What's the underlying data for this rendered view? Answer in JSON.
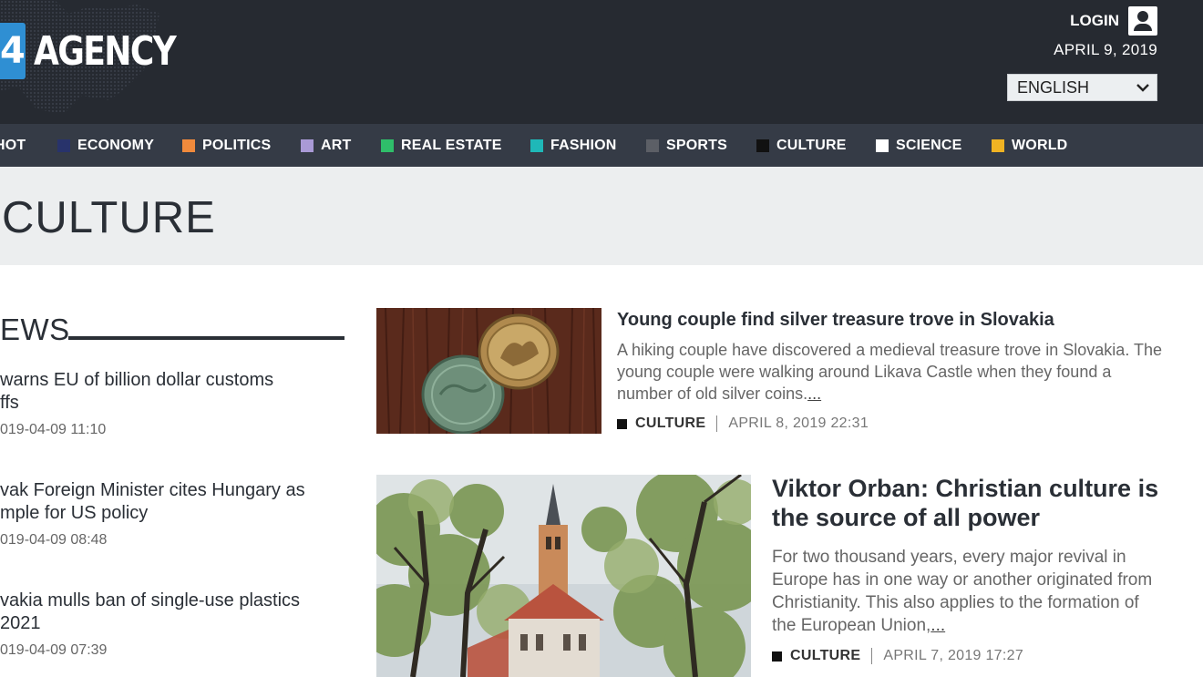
{
  "header": {
    "logo_digit": "4",
    "logo_text": "AGENCY",
    "login_label": "LOGIN",
    "date": "APRIL 9, 2019",
    "language": "ENGLISH"
  },
  "nav": {
    "items": [
      {
        "label": "HOT",
        "color": "#c9302c"
      },
      {
        "label": "ECONOMY",
        "color": "#28336b"
      },
      {
        "label": "POLITICS",
        "color": "#f08a3c"
      },
      {
        "label": "ART",
        "color": "#a99ad6"
      },
      {
        "label": "REAL ESTATE",
        "color": "#2fbe6a"
      },
      {
        "label": "FASHION",
        "color": "#1fb8b8"
      },
      {
        "label": "SPORTS",
        "color": "#5c5f66"
      },
      {
        "label": "CULTURE",
        "color": "#111111"
      },
      {
        "label": "SCIENCE",
        "color": "#ffffff"
      },
      {
        "label": "WORLD",
        "color": "#f0b323"
      }
    ]
  },
  "banner": {
    "title": "CULTURE"
  },
  "sidebar": {
    "heading": "EWS",
    "items": [
      {
        "title_line1": "warns EU of billion dollar customs",
        "title_line2": "ffs",
        "time": "019-04-09 11:10"
      },
      {
        "title_line1": "vak Foreign Minister cites Hungary as",
        "title_line2": "mple for US policy",
        "time": "019-04-09 08:48"
      },
      {
        "title_line1": "vakia mulls ban of single-use plastics",
        "title_line2": "2021",
        "time": "019-04-09 07:39"
      }
    ]
  },
  "articles": [
    {
      "title": "Young couple find silver treasure trove in Slovakia",
      "desc": "A hiking couple have discovered a medieval treasure trove in Slovakia. The young couple were walking around Likava Castle when they found a number of old silver coins.",
      "more": "...",
      "category": "CULTURE",
      "date": "APRIL 8, 2019 22:31"
    },
    {
      "title": "Viktor Orban: Christian culture is the source of all power",
      "desc": "For two thousand years, every major revival in Europe has in one way or another originated from Christianity. This also applies to the formation of the European Union,",
      "more": "...",
      "category": "CULTURE",
      "date": "APRIL 7, 2019 17:27"
    }
  ]
}
